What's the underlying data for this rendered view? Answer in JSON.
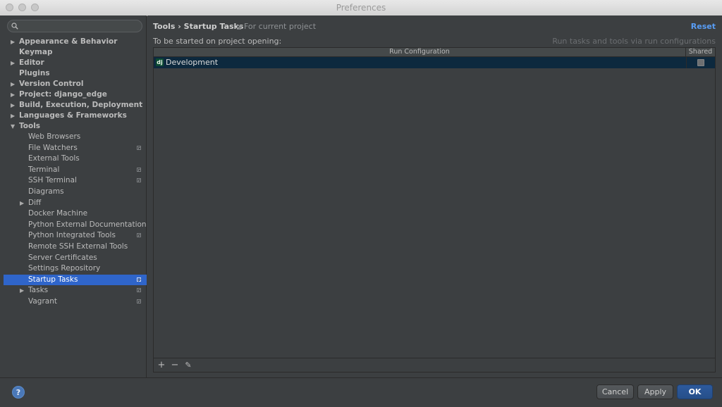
{
  "window": {
    "title": "Preferences"
  },
  "sidebar": {
    "search_placeholder": "",
    "items": [
      {
        "label": "Appearance & Behavior",
        "level": 0,
        "arrow": "collapsed",
        "project": false,
        "selected": false
      },
      {
        "label": "Keymap",
        "level": 0,
        "arrow": "none",
        "project": false,
        "selected": false
      },
      {
        "label": "Editor",
        "level": 0,
        "arrow": "collapsed",
        "project": false,
        "selected": false
      },
      {
        "label": "Plugins",
        "level": 0,
        "arrow": "none",
        "project": false,
        "selected": false
      },
      {
        "label": "Version Control",
        "level": 0,
        "arrow": "collapsed",
        "project": false,
        "selected": false
      },
      {
        "label": "Project: django_edge",
        "level": 0,
        "arrow": "collapsed",
        "project": false,
        "selected": false
      },
      {
        "label": "Build, Execution, Deployment",
        "level": 0,
        "arrow": "collapsed",
        "project": false,
        "selected": false
      },
      {
        "label": "Languages & Frameworks",
        "level": 0,
        "arrow": "collapsed",
        "project": false,
        "selected": false
      },
      {
        "label": "Tools",
        "level": 0,
        "arrow": "expanded",
        "project": false,
        "selected": false
      },
      {
        "label": "Web Browsers",
        "level": 1,
        "arrow": "none",
        "project": false,
        "selected": false
      },
      {
        "label": "File Watchers",
        "level": 1,
        "arrow": "none",
        "project": true,
        "selected": false
      },
      {
        "label": "External Tools",
        "level": 1,
        "arrow": "none",
        "project": false,
        "selected": false
      },
      {
        "label": "Terminal",
        "level": 1,
        "arrow": "none",
        "project": true,
        "selected": false
      },
      {
        "label": "SSH Terminal",
        "level": 1,
        "arrow": "none",
        "project": true,
        "selected": false
      },
      {
        "label": "Diagrams",
        "level": 1,
        "arrow": "none",
        "project": false,
        "selected": false
      },
      {
        "label": "Diff",
        "level": 1,
        "arrow": "collapsed",
        "project": false,
        "selected": false
      },
      {
        "label": "Docker Machine",
        "level": 1,
        "arrow": "none",
        "project": false,
        "selected": false
      },
      {
        "label": "Python External Documentation",
        "level": 1,
        "arrow": "none",
        "project": false,
        "selected": false
      },
      {
        "label": "Python Integrated Tools",
        "level": 1,
        "arrow": "none",
        "project": true,
        "selected": false
      },
      {
        "label": "Remote SSH External Tools",
        "level": 1,
        "arrow": "none",
        "project": false,
        "selected": false
      },
      {
        "label": "Server Certificates",
        "level": 1,
        "arrow": "none",
        "project": false,
        "selected": false
      },
      {
        "label": "Settings Repository",
        "level": 1,
        "arrow": "none",
        "project": false,
        "selected": false
      },
      {
        "label": "Startup Tasks",
        "level": 1,
        "arrow": "none",
        "project": true,
        "selected": true
      },
      {
        "label": "Tasks",
        "level": 1,
        "arrow": "collapsed",
        "project": true,
        "selected": false
      },
      {
        "label": "Vagrant",
        "level": 1,
        "arrow": "none",
        "project": true,
        "selected": false
      }
    ]
  },
  "content": {
    "breadcrumb": "Tools › Startup Tasks",
    "scope": "For current project",
    "reset_label": "Reset",
    "subtitle": "To be started on project opening:",
    "hint": "Run tasks and tools via run configurations",
    "table": {
      "columns": [
        "Run Configuration",
        "Shared"
      ],
      "rows": [
        {
          "icon_text": "dj",
          "name": "Development",
          "shared": false
        }
      ]
    },
    "toolbar": {
      "add": "+",
      "remove": "−",
      "edit": "✎"
    }
  },
  "footer": {
    "help": "?",
    "cancel_label": "Cancel",
    "apply_label": "Apply",
    "ok_label": "OK"
  },
  "colors": {
    "selection": "#2f65ca",
    "link": "#589df6",
    "row_selected": "#0d293e"
  }
}
